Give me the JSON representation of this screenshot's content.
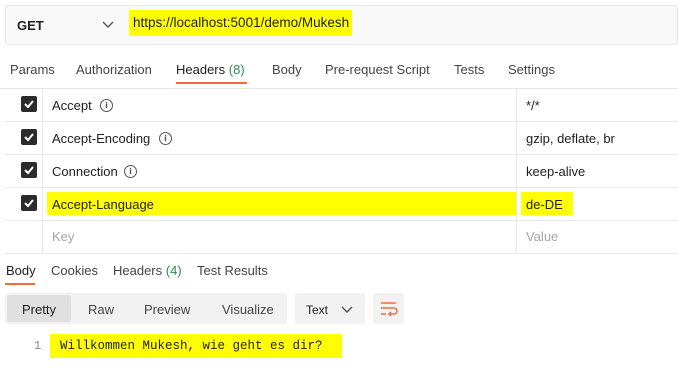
{
  "request": {
    "method": "GET",
    "url": "https://localhost:5001/demo/Mukesh"
  },
  "request_tabs": {
    "params": "Params",
    "authorization": "Authorization",
    "headers": "Headers",
    "headers_count": "(8)",
    "body": "Body",
    "prerequest": "Pre-request Script",
    "tests": "Tests",
    "settings": "Settings"
  },
  "headers": [
    {
      "key": "Accept",
      "value": "*/*",
      "checked": true
    },
    {
      "key": "Accept-Encoding",
      "value": "gzip, deflate, br",
      "checked": true
    },
    {
      "key": "Connection",
      "value": "keep-alive",
      "checked": true
    },
    {
      "key": "Accept-Language",
      "value": "de-DE",
      "checked": true
    }
  ],
  "headers_placeholder": {
    "key": "Key",
    "value": "Value"
  },
  "info_glyph": "i",
  "response_tabs": {
    "body": "Body",
    "cookies": "Cookies",
    "headers": "Headers",
    "headers_count": "(4)",
    "test_results": "Test Results"
  },
  "view_modes": {
    "pretty": "Pretty",
    "raw": "Raw",
    "preview": "Preview",
    "visualize": "Visualize",
    "format": "Text"
  },
  "response_body": {
    "line_number": "1",
    "text": "Willkommen Mukesh, wie geht es dir?"
  },
  "colors": {
    "highlight": "#ffff00",
    "accent": "#f26b3a",
    "count": "#2e8b57"
  }
}
